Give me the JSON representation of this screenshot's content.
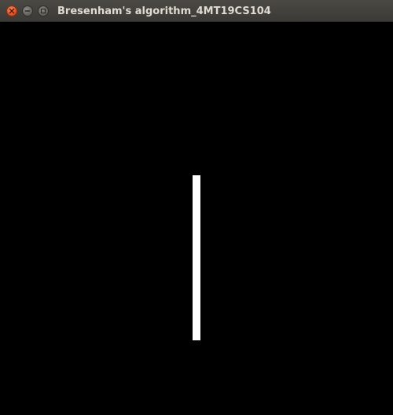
{
  "window": {
    "title": "Bresenham's algorithm_4MT19CS104",
    "controls": [
      "close-icon",
      "minimize-icon",
      "maximize-icon"
    ]
  },
  "canvas": {
    "background": "#000000",
    "line_color": "#ffffff"
  },
  "colors": {
    "titlebar": "#3c3b37",
    "close_button": "#df4a16",
    "title_text": "#dfdbd2"
  }
}
